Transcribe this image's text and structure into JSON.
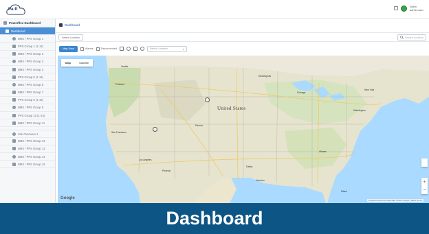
{
  "header": {
    "logo_text": "Pa-ft",
    "user_line1": "Valon",
    "user_line2": "admin-user"
  },
  "sidebar": {
    "title": "Powerflex Dashboard",
    "items": [
      {
        "label": "Dashboard",
        "active": true
      },
      {
        "label": "BMS / PPS Group 1"
      },
      {
        "label": "PPS Group 1 (1-14)"
      },
      {
        "label": "BMS / PPS Group 2"
      },
      {
        "label": "BMS / PPS Group 3"
      },
      {
        "label": "BMS / PPS Group 4"
      },
      {
        "label": "PPS Group 5 (1-14)"
      },
      {
        "label": "BMS / PPS Group 6"
      },
      {
        "label": "BMS / PPS Group 7"
      },
      {
        "label": "PPS Group 8 (1-14)"
      },
      {
        "label": "BMS / PPS Group 9"
      },
      {
        "label": "PPS Group 10 (1-14)"
      },
      {
        "label": "BMS / PPS Group 11"
      },
      {
        "label": "Site Overview 1"
      },
      {
        "label": "BMS / PPS Group 12"
      },
      {
        "label": "BMS / PPS Group 13"
      },
      {
        "label": "BMS / PPS Group 14"
      },
      {
        "label": "BMS / PPS Group 15"
      }
    ]
  },
  "breadcrumb": {
    "label": "Dashboard"
  },
  "toolbar": {
    "filter_label": "Select Location",
    "search_placeholder": "Search Address",
    "view_button": "Map View",
    "checkbox1": "Alarms",
    "checkbox2": "Disconnected",
    "select_placeholder": "Select Location"
  },
  "map": {
    "type_map": "Map",
    "type_satellite": "Satellite",
    "country_label": "United States",
    "google": "Google",
    "copyright": "Keyboard shortcuts  Map data ©2023 Google, INEGI  Terms",
    "zoom_in": "+",
    "zoom_out": "−",
    "cities": [
      "Seattle",
      "Portland",
      "San Francisco",
      "Los Angeles",
      "Phoenix",
      "Denver",
      "Dallas",
      "Houston",
      "Chicago",
      "New York",
      "Atlanta",
      "Miami",
      "Minneapolis",
      "Washington"
    ]
  },
  "banner": {
    "title": "Dashboard"
  },
  "colors": {
    "accent": "#4a8fd6",
    "banner": "#0d5584",
    "button": "#3b86d1",
    "status_ok": "#3aa34a",
    "water": "#aadaff",
    "land": "#e8e6d6"
  }
}
